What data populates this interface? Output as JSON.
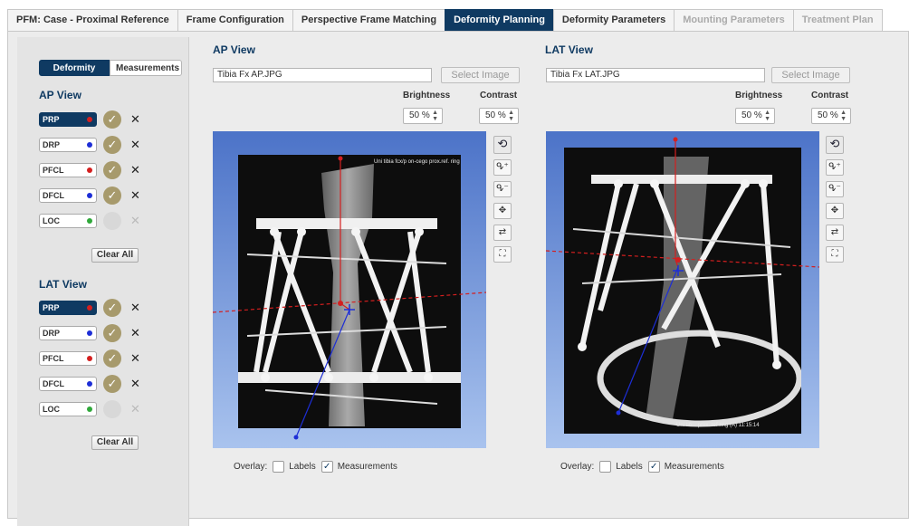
{
  "tabs": [
    {
      "label": "PFM: Case - Proximal Reference",
      "state": "normal"
    },
    {
      "label": "Frame Configuration",
      "state": "normal"
    },
    {
      "label": "Perspective Frame Matching",
      "state": "normal"
    },
    {
      "label": "Deformity Planning",
      "state": "active"
    },
    {
      "label": "Deformity Parameters",
      "state": "normal"
    },
    {
      "label": "Mounting Parameters",
      "state": "disabled"
    },
    {
      "label": "Treatment Plan",
      "state": "disabled"
    }
  ],
  "sidebar": {
    "toggle": {
      "deformity": "Deformity",
      "measurements": "Measurements"
    },
    "ap_title": "AP View",
    "lat_title": "LAT View",
    "clear_all": "Clear All",
    "ap_rows": [
      {
        "label": "PRP",
        "dot": "#d41f1f",
        "selected": true,
        "set": true
      },
      {
        "label": "DRP",
        "dot": "#1d2ed6",
        "selected": false,
        "set": true
      },
      {
        "label": "PFCL",
        "dot": "#d41f1f",
        "selected": false,
        "set": true
      },
      {
        "label": "DFCL",
        "dot": "#1d2ed6",
        "selected": false,
        "set": true
      },
      {
        "label": "LOC",
        "dot": "#2fa83a",
        "selected": false,
        "set": false
      }
    ],
    "lat_rows": [
      {
        "label": "PRP",
        "dot": "#d41f1f",
        "selected": true,
        "set": true
      },
      {
        "label": "DRP",
        "dot": "#1d2ed6",
        "selected": false,
        "set": true
      },
      {
        "label": "PFCL",
        "dot": "#d41f1f",
        "selected": false,
        "set": true
      },
      {
        "label": "DFCL",
        "dot": "#1d2ed6",
        "selected": false,
        "set": true
      },
      {
        "label": "LOC",
        "dot": "#2fa83a",
        "selected": false,
        "set": false
      }
    ]
  },
  "ap": {
    "title": "AP View",
    "file": "Tibia Fx AP.JPG",
    "select_image": "Select Image",
    "brightness_label": "Brightness",
    "contrast_label": "Contrast",
    "brightness": "50 %",
    "contrast": "50 %",
    "image_caption": "Uni tibia fcx/p on-cego prox.ref. ring"
  },
  "lat": {
    "title": "LAT View",
    "file": "Tibia Fx LAT.JPG",
    "select_image": "Select Image",
    "brightness_label": "Brightness",
    "contrast_label": "Contrast",
    "brightness": "50 %",
    "contrast": "50 %",
    "image_caption": "Uni tib... prox. ref ring (A) 11:15:14"
  },
  "overlay": {
    "label": "Overlay:",
    "labels": "Labels",
    "measurements": "Measurements",
    "labels_checked": false,
    "measurements_checked": true
  },
  "colors": {
    "accent": "#0f3a62",
    "proximal": "#d41f1f",
    "distal": "#1d2ed6"
  },
  "icons": [
    "undo-icon",
    "zoom-in-icon",
    "zoom-out-icon",
    "pan-icon",
    "rotate-icon",
    "fit-to-screen-icon"
  ]
}
